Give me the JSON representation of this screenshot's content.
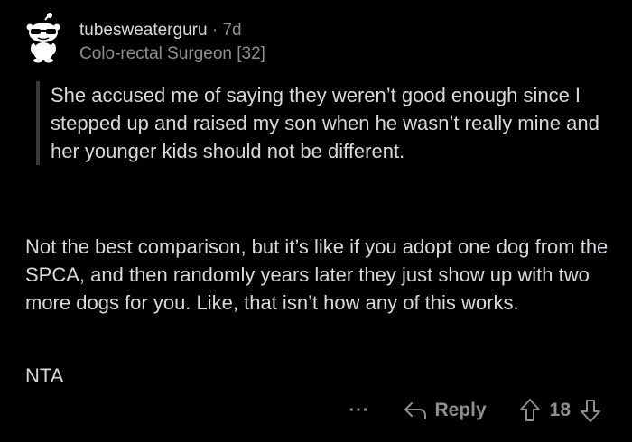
{
  "comment": {
    "username": "tubesweaterguru",
    "separator": "·",
    "age": "7d",
    "flair": "Colo-rectal Surgeon [32]",
    "quote": "She accused me of saying they weren’t good enough since I stepped up and raised my son when he wasn’t really mine and her younger kids should not be different.",
    "paragraphs": [
      "Not the best comparison, but it’s like if you adopt one dog from the SPCA, and then randomly years later they just show up with two more dogs for you. Like, that isn’t how any of this works.",
      "NTA"
    ]
  },
  "actions": {
    "more": "···",
    "reply": "Reply",
    "score": "18"
  },
  "icons": {
    "avatar": "reddit-snoo-sunglasses-avatar",
    "reply": "reply-arrow-icon",
    "upvote": "upvote-arrow-icon",
    "downvote": "downvote-arrow-icon"
  },
  "colors": {
    "background": "#000000",
    "text": "#d7dadc",
    "muted": "#8e8e93",
    "quote_bar": "#3a3a3c"
  }
}
